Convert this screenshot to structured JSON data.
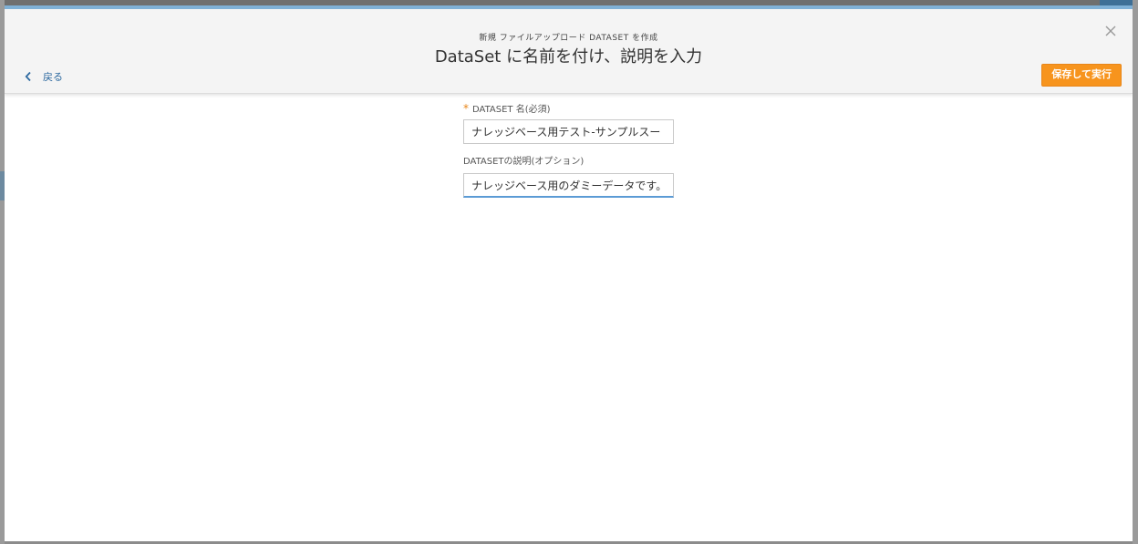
{
  "modal": {
    "subtitle": "新規 ファイルアップロード DATASET を作成",
    "title": "DataSet に名前を付け、説明を入力",
    "back_label": "戻る",
    "save_run_label": "保存して実行",
    "close_icon": "close-icon",
    "back_icon": "chevron-left-icon"
  },
  "form": {
    "name_required_mark": "*",
    "name_label": "DATASET 名(必須)",
    "name_value": "ナレッジベース用テスト-サンプルスー",
    "description_label": "DATASETの説明(オプション)",
    "description_value": "ナレッジベース用のダミーデータです。"
  },
  "colors": {
    "accent_button": "#f7941d",
    "link": "#2e6aa0",
    "focus_underline": "#5b9bd5",
    "top_border": "#7fb0d6"
  }
}
